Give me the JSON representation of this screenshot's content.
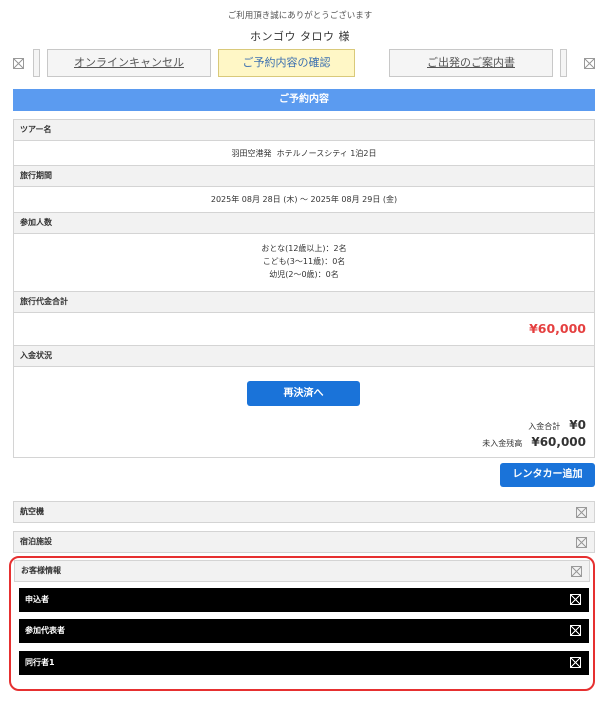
{
  "header": {
    "thanks": "ご利用頂き誠にありがとうございます",
    "customer_name": "ホンゴウ タロウ 様"
  },
  "tabs": {
    "cancel": "オンラインキャンセル",
    "confirm": "ご予約内容の確認",
    "guide": "ご出発のご案内書"
  },
  "section_title": "ご予約内容",
  "reservation": {
    "tour_label": "ツアー名",
    "tour_value": "羽田空港発  ホテルノースシティ 1泊2日",
    "period_label": "旅行期間",
    "period_value": "2025年 08月 28日 (木) ～ 2025年 08月 29日 (金)",
    "participants_label": "参加人数",
    "adults": "おとな(12歳以上)：2名",
    "children": "こども(3～11歳)：0名",
    "infants": "幼児(2～0歳)：0名",
    "total_label": "旅行代金合計",
    "total_value": "¥60,000",
    "payment_label": "入金状況",
    "repay_button": "再決済へ",
    "paid_label": "入金合計",
    "paid_value": "¥0",
    "unpaid_label": "未入金残高",
    "unpaid_value": "¥60,000"
  },
  "rental_button": "レンタカー追加",
  "sections": {
    "flight": "航空機",
    "hotel": "宿泊施設",
    "customer_info": "お客様情報",
    "applicant": "申込者",
    "representative": "参加代表者",
    "companion1": "同行者1"
  },
  "colors": {
    "accent": "#5b9bf0",
    "button": "#1a73d9",
    "price": "#e54040",
    "highlight": "#e63030",
    "active_tab": "#fff7c6"
  }
}
